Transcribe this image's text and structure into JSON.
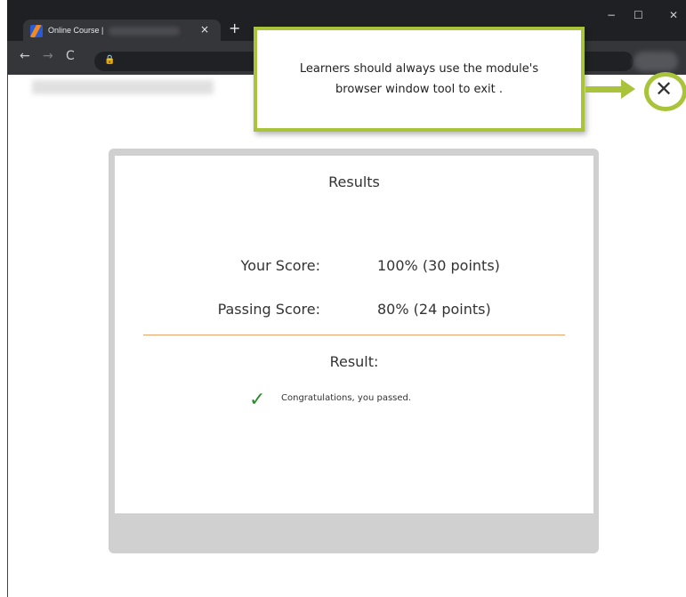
{
  "browser": {
    "tab_title": "Online Course |",
    "tab_close": "×",
    "new_tab": "+",
    "nav_back": "←",
    "nav_forward": "→",
    "nav_reload": "C",
    "lock": "🔒",
    "win_minimize": "−",
    "win_maximize": "☐",
    "win_close": "✕"
  },
  "callout": {
    "line1": "Learners should always use the module's",
    "line2": "browser window tool to exit .",
    "accent_color": "#a9c43b"
  },
  "page": {
    "close_glyph": "✕"
  },
  "results": {
    "title": "Results",
    "your_score_label": "Your Score:",
    "your_score_value": "100% (30 points)",
    "passing_score_label": "Passing Score:",
    "passing_score_value": "80% (24 points)",
    "result_label": "Result:",
    "check_glyph": "✓",
    "message": "Congratulations, you passed."
  }
}
